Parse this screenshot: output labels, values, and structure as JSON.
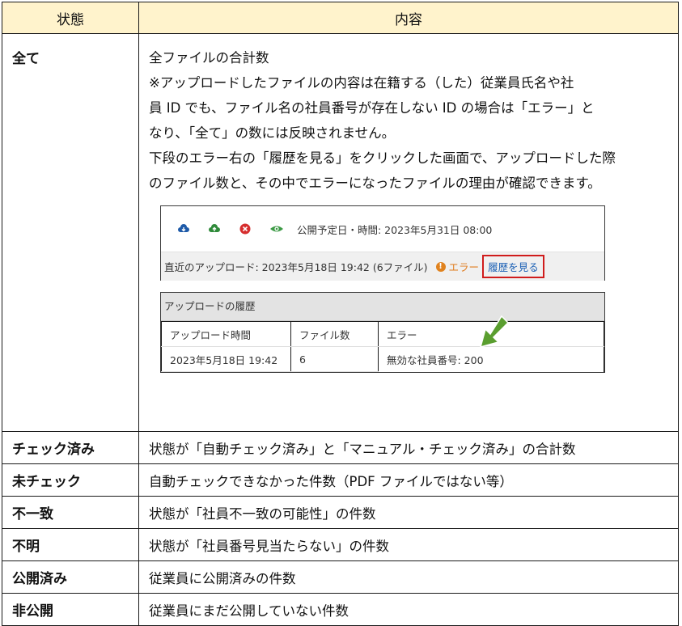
{
  "header": {
    "status": "状態",
    "content": "内容"
  },
  "row_all": {
    "status": "全て",
    "line1": "全ファイルの合計数",
    "line2": "※アップロードしたファイルの内容は在籍する（した）従業員氏名や社",
    "line3": "員 ID でも、ファイル名の社員番号が存在しない ID の場合は「エラー」と",
    "line4": "なり、「全て」の数には反映されません。",
    "line5": "下段のエラー右の「履歴を見る」をクリックした画面で、アップロードした際",
    "line6": "のファイル数と、その中でエラーになったファイルの理由が確認できます。"
  },
  "screenshot_top": {
    "publish_info": "公開予定日・時間: 2023年5月31日 08:00",
    "recent_upload": "直近のアップロード: 2023年5月18日 19:42 (6ファイル)",
    "error_mark": "!",
    "error_label": "エラー",
    "history_link": "履歴を見る"
  },
  "screenshot_history": {
    "title": "アップロードの履歴",
    "columns": [
      "アップロード時間",
      "ファイル数",
      "エラー"
    ],
    "row": [
      "2023年5月18日 19:42",
      "6",
      "無効な社員番号: 200"
    ]
  },
  "rows": [
    {
      "status": "チェック済み",
      "content": "状態が「自動チェック済み」と「マニュアル・チェック済み」の合計数"
    },
    {
      "status": "未チェック",
      "content": "自動チェックできなかった件数（PDF ファイルではない等）"
    },
    {
      "status": "不一致",
      "content": "状態が「社員不一致の可能性」の件数"
    },
    {
      "status": "不明",
      "content": "状態が「社員番号見当たらない」の件数"
    },
    {
      "status": "公開済み",
      "content": "従業員に公開済みの件数"
    },
    {
      "status": "非公開",
      "content": "従業員にまだ公開していない件数"
    }
  ],
  "colors": {
    "header_bg": "#fff3cc",
    "highlight_border": "#d01c1c",
    "link": "#1a5fb4",
    "arrow": "#5a9e2f"
  }
}
